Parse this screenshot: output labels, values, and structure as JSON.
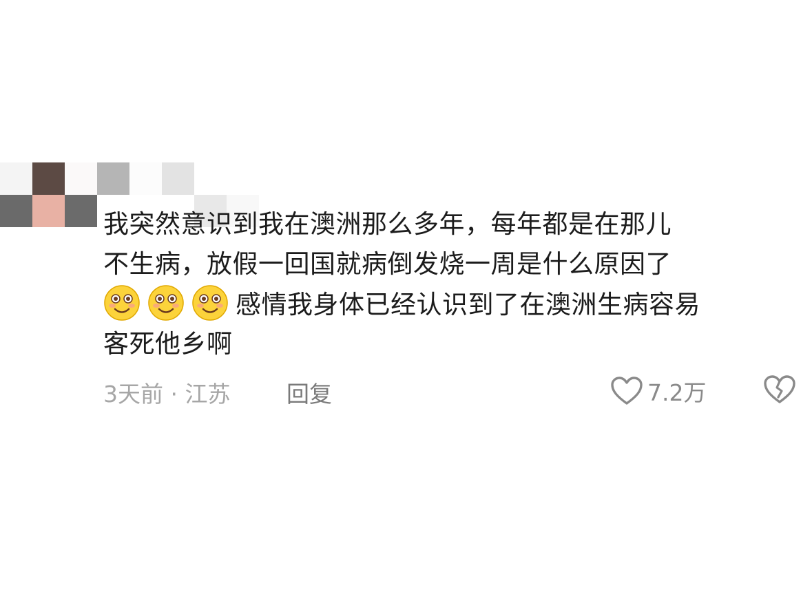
{
  "colors": {
    "text": "#1c1c1c",
    "meta": "#a6a6a6",
    "reply": "#7a7a7a",
    "emoji_face": "#fcd33b",
    "emoji_blush": "#f7a08a"
  },
  "comment": {
    "author_icon": "pixelated-avatar-and-username",
    "mosaic_colors": [
      "#f4f4f4",
      "#5c4a44",
      "#fbf9f9",
      "#b5b5b5",
      "#fcfcfc",
      "#e3e3e3",
      "#ffffff",
      "#ffffff",
      "#6a6a6a",
      "#e8b1a4",
      "#6b6b6b",
      "#ffffff",
      "#ffffff",
      "#ffffff",
      "#e8e8e8",
      "#f8f8f8"
    ],
    "lines": [
      "我突然意识到我在澳洲那么多年，每年都是在那儿",
      "不生病，放假一回国就病倒发烧一周是什么原因了",
      "感情我身体已经认识到了在澳洲生病容易",
      "客死他乡啊"
    ],
    "emoji_icon": "blushing-smile-emoji",
    "emoji_count": 3
  },
  "meta": {
    "time_location": "3天前 · 江苏",
    "reply_label": "回复",
    "like_icon": "heart-outline-icon",
    "like_count": "7.2万",
    "dislike_icon": "broken-heart-icon"
  }
}
